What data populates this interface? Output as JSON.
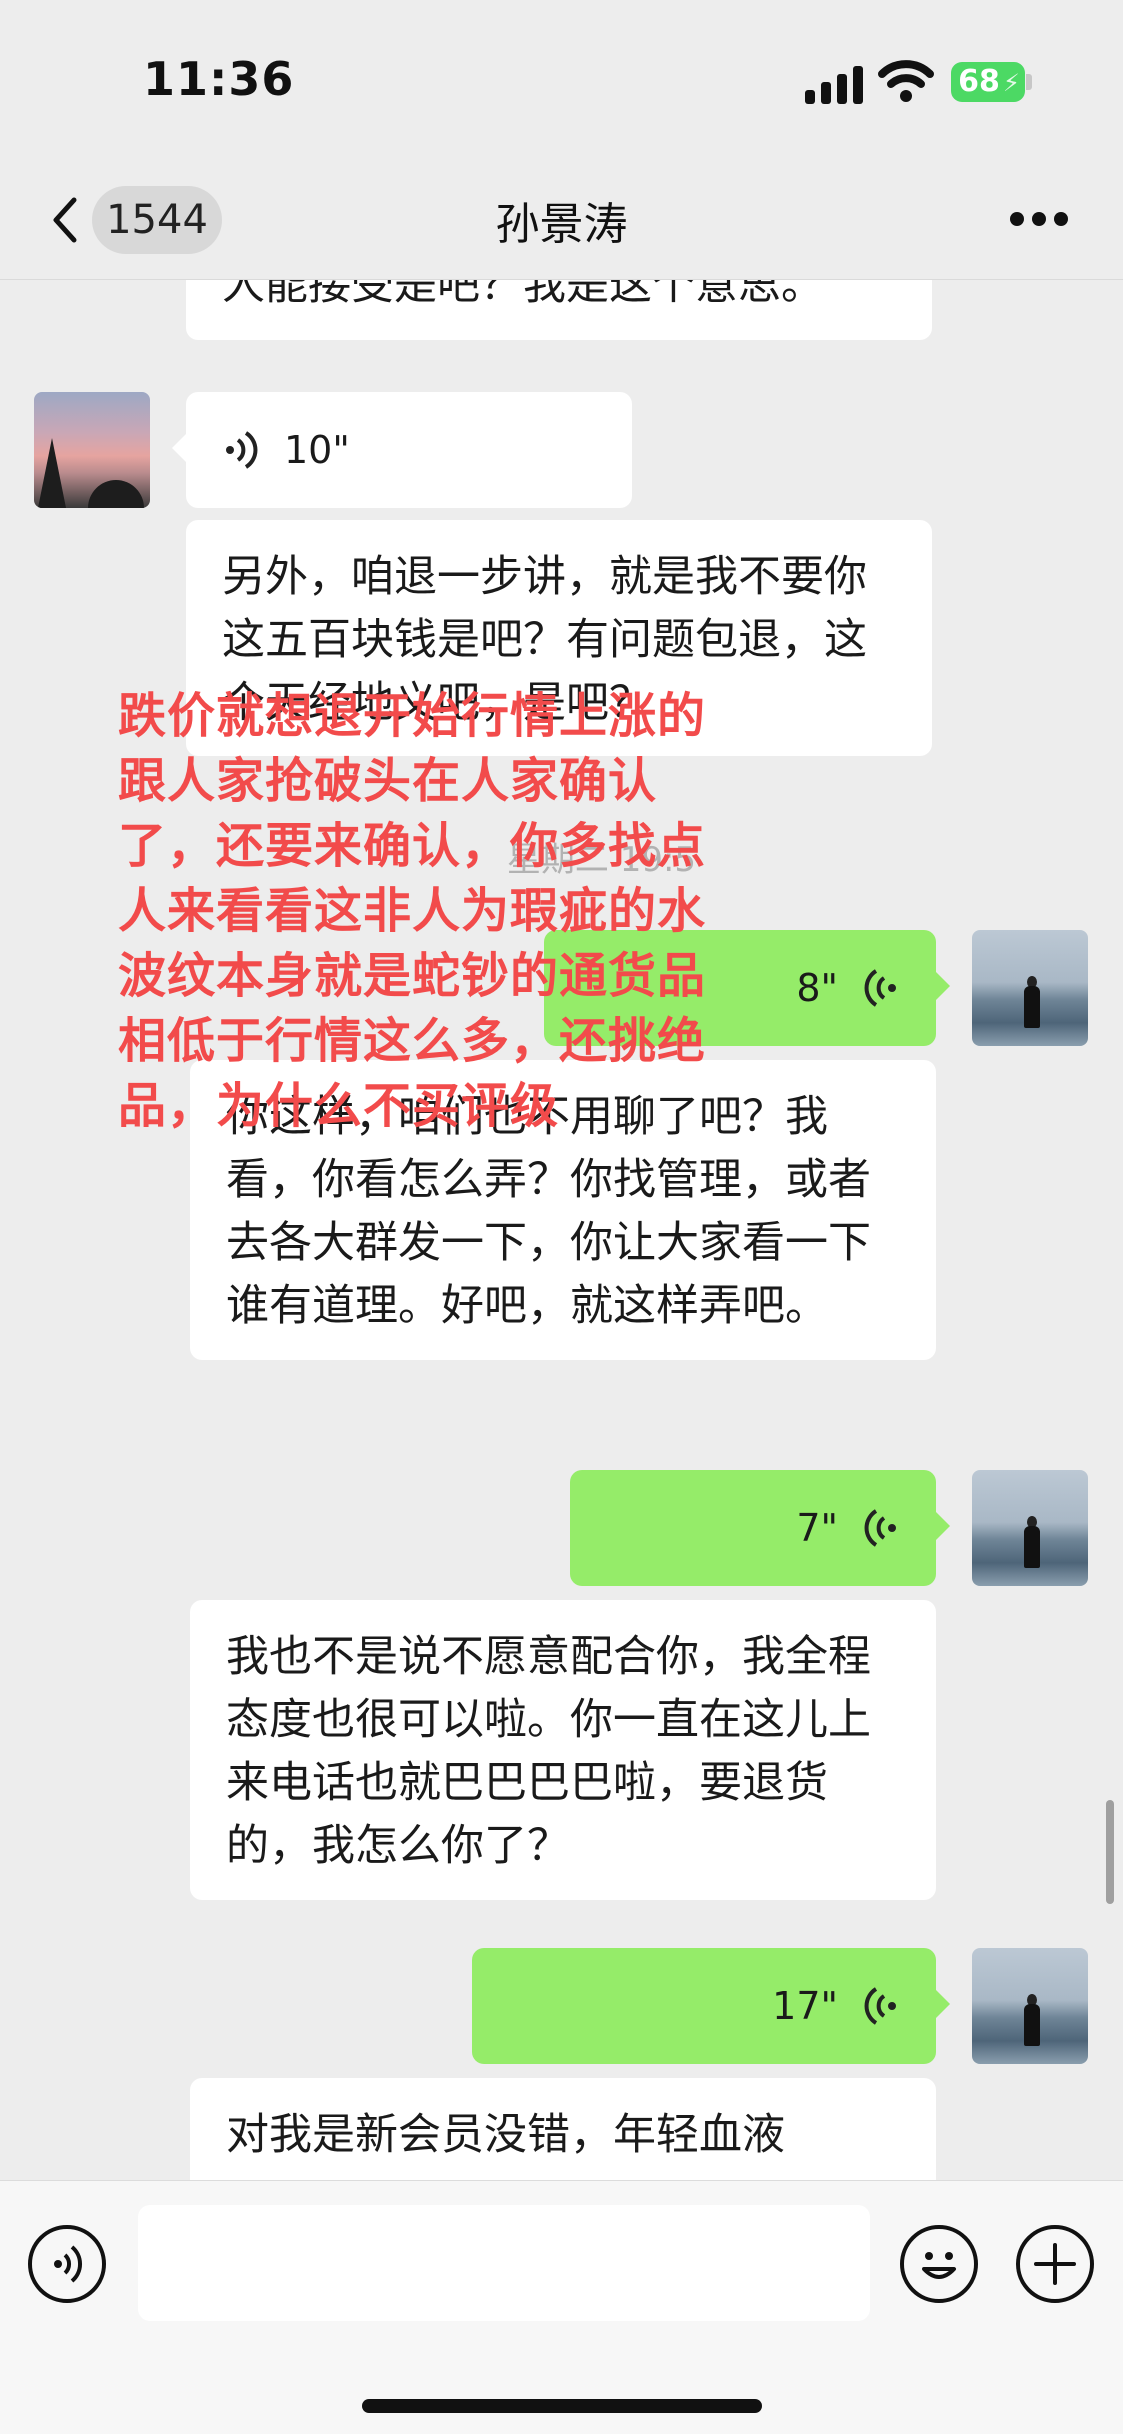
{
  "status_bar": {
    "time": "11:36",
    "battery": "68",
    "battery_color": "#4cd964"
  },
  "nav": {
    "unread_count": "1544",
    "title": "孙景涛"
  },
  "messages": {
    "top_cut": "人能接受是吧？我是这个意思。",
    "voice_in_1": "10\"",
    "text_in_1": "另外，咱退一步讲，就是我不要你这五百块钱是吧？有问题包退，这个天经地义吧，是吧？",
    "timestamp": "星期二 19:5",
    "voice_out_1": "8\"",
    "text_in_2": "你这样，咱们也不用聊了吧？我看，你看怎么弄？你找管理，或者去各大群发一下，你让大家看一下谁有道理。好吧，就这样弄吧。",
    "voice_out_2": "7\"",
    "text_in_3": "我也不是说不愿意配合你，我全程态度也很可以啦。你一直在这儿上来电话也就巴巴巴巴啦，要退货的，我怎么你了？",
    "voice_out_3": "17\"",
    "text_in_4": "对我是新会员没错，年轻血液"
  },
  "overlay_text": "跌价就想退开始行情上涨的跟人家抢破头在人家确认了，还要来确认，你多找点人来看看这非人为瑕疵的水波纹本身就是蛇钞的通货品相低于行情这么多，还挑绝品，为什么不买评级",
  "colors": {
    "bubble_mine": "#95ec69",
    "bubble_theirs": "#ffffff",
    "overlay": "#f24b4b",
    "background": "#ededed"
  },
  "icons": [
    "back-chevron-icon",
    "more-dots-icon",
    "voice-wave-icon",
    "voice-input-icon",
    "emoji-icon",
    "plus-icon"
  ]
}
